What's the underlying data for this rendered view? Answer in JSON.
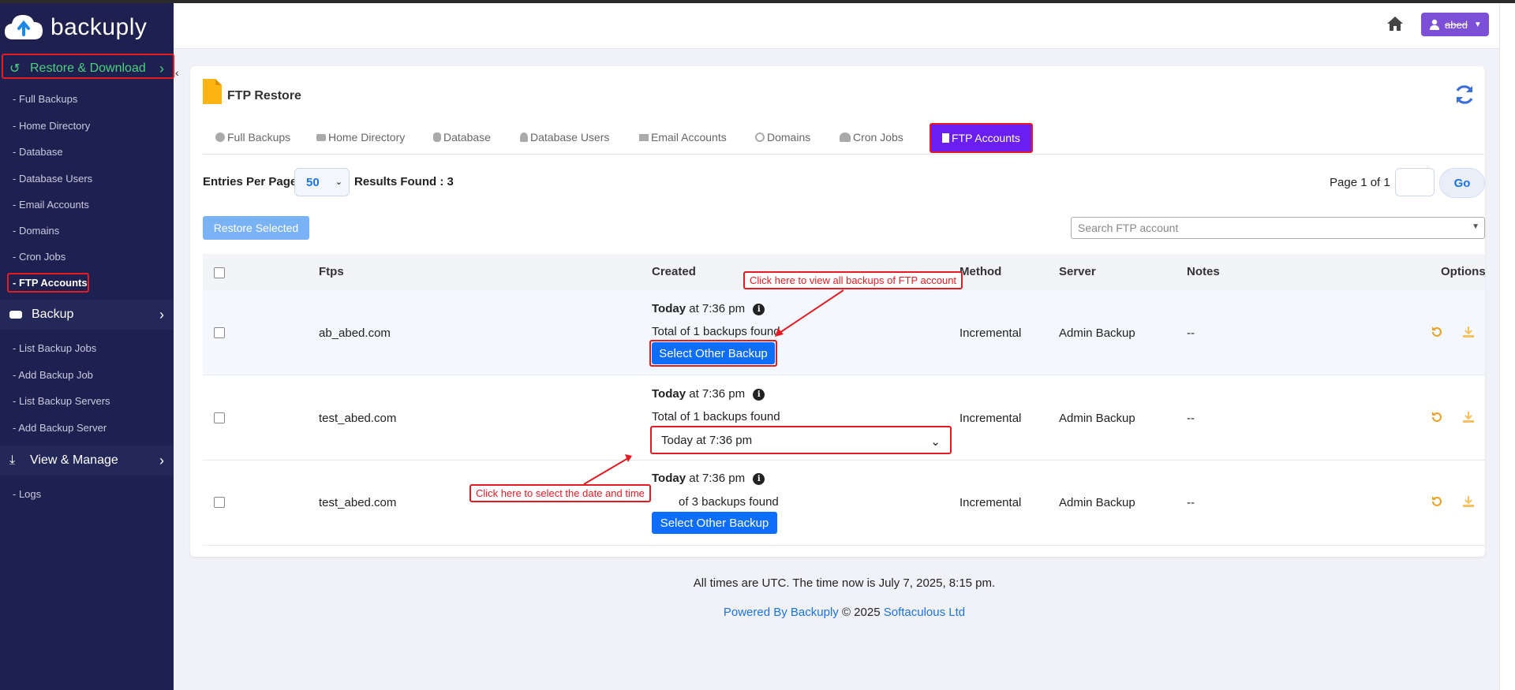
{
  "brand": {
    "name": "backuply"
  },
  "sidebar": {
    "restore_header": "Restore & Download",
    "restore_items": [
      "- Full Backups",
      "- Home Directory",
      "- Database",
      "- Database Users",
      "- Email Accounts",
      "- Domains",
      "- Cron Jobs",
      "- FTP Accounts"
    ],
    "backup_header": "Backup",
    "backup_items": [
      "- List Backup Jobs",
      "- Add Backup Job",
      "- List Backup Servers",
      "- Add Backup Server"
    ],
    "view_header": "View & Manage",
    "view_items": [
      "- Logs"
    ]
  },
  "topbar": {
    "user_label": "abed"
  },
  "card": {
    "title": "FTP Restore",
    "tabs": [
      "Full Backups",
      "Home Directory",
      "Database",
      "Database Users",
      "Email Accounts",
      "Domains",
      "Cron Jobs",
      "FTP Accounts"
    ],
    "active_tab": "FTP Accounts",
    "entries_label": "Entries Per Page",
    "entries_value": "50",
    "results_found": "Results Found : 3",
    "page_info": "Page 1 of 1",
    "go_label": "Go",
    "restore_selected": "Restore Selected",
    "search_placeholder": "Search FTP account"
  },
  "table": {
    "headers": {
      "ftps": "Ftps",
      "created": "Created",
      "method": "Method",
      "server": "Server",
      "notes": "Notes",
      "options": "Options"
    },
    "rows": [
      {
        "ftp": "ab_abed.com",
        "today": "Today",
        "time": "at 7:36 pm",
        "total": "Total of 1 backups found",
        "action": "Select Other Backup",
        "method": "Incremental",
        "server": "Admin Backup",
        "notes": "--"
      },
      {
        "ftp": "test_abed.com",
        "today": "Today",
        "time": "at 7:36 pm",
        "total": "Total of 1 backups found",
        "select_value": "Today at 7:36 pm",
        "method": "Incremental",
        "server": "Admin Backup",
        "notes": "--"
      },
      {
        "ftp": "test_abed.com",
        "today": "Today",
        "time": "at 7:36 pm",
        "total": "of 3 backups found",
        "action": "Select Other Backup",
        "method": "Incremental",
        "server": "Admin Backup",
        "notes": "--"
      }
    ]
  },
  "annotations": {
    "view_all": "Click here to view all backups of FTP account",
    "select_date": "Click here to select the date and time"
  },
  "footer": {
    "time_note": "All times are UTC. The time now is July 7, 2025, 8:15 pm.",
    "powered_by": "Powered By Backuply",
    "copyright": "© 2025",
    "company": "Softaculous Ltd"
  },
  "colors": {
    "sidebar_bg": "#1e2150",
    "active_green": "#4ad27e",
    "accent_purple": "#6a1ff0",
    "primary_blue": "#0d6efd",
    "annotation_red": "#e41b23",
    "option_orange": "#f0a020"
  },
  "icons": {
    "home": "home-icon",
    "user": "user-icon",
    "refresh": "refresh-icon",
    "file": "file-icon",
    "restore": "restore-icon",
    "download": "download-icon",
    "info": "info-icon"
  }
}
